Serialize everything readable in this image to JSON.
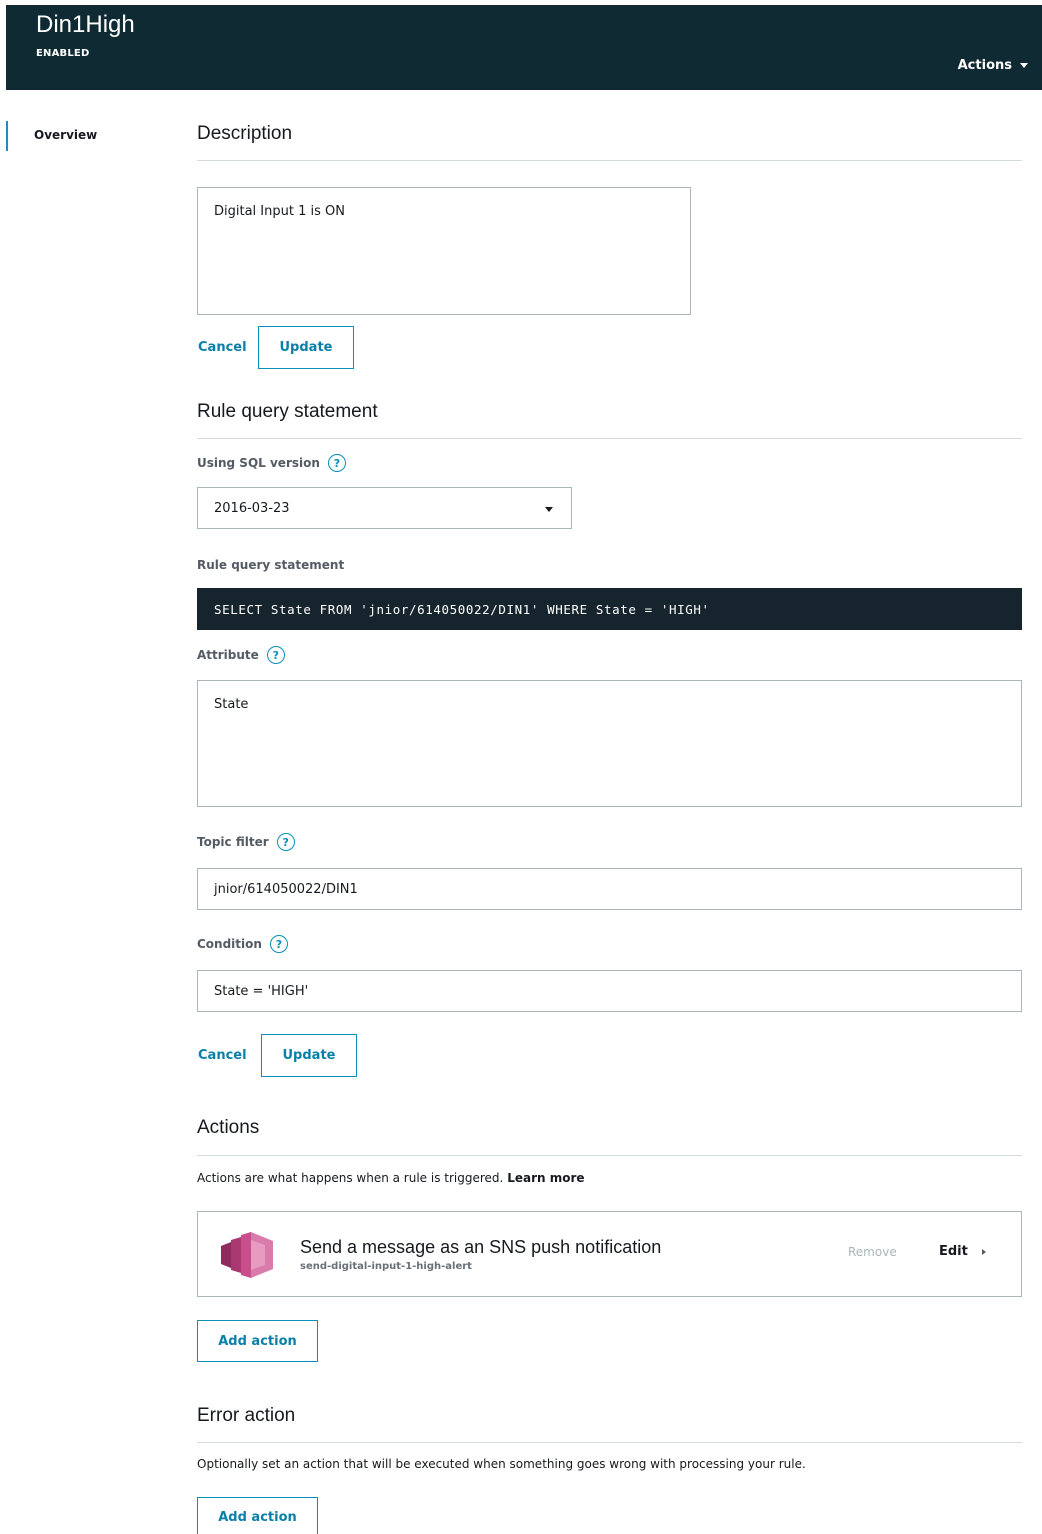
{
  "header": {
    "title": "Din1High",
    "status": "ENABLED",
    "actions_label": "Actions"
  },
  "nav": {
    "overview_label": "Overview"
  },
  "description": {
    "section_title": "Description",
    "value": "Digital Input 1 is ON",
    "cancel_label": "Cancel",
    "update_label": "Update"
  },
  "rule_query": {
    "section_title": "Rule query statement",
    "sql_version_label": "Using SQL version",
    "sql_version_value": "2016-03-23",
    "statement_label": "Rule query statement",
    "statement_value": "SELECT State FROM 'jnior/614050022/DIN1' WHERE State = 'HIGH'",
    "attribute_label": "Attribute",
    "attribute_value": "State",
    "topic_filter_label": "Topic filter",
    "topic_filter_value": "jnior/614050022/DIN1",
    "condition_label": "Condition",
    "condition_value": "State = 'HIGH'",
    "cancel_label": "Cancel",
    "update_label": "Update"
  },
  "actions": {
    "section_title": "Actions",
    "helper_text": "Actions are what happens when a rule is triggered.",
    "learn_more_label": "Learn more",
    "items": [
      {
        "name": "Send a message as an SNS push notification",
        "target": "send-digital-input-1-high-alert",
        "remove_label": "Remove",
        "edit_label": "Edit"
      }
    ],
    "add_action_label": "Add action"
  },
  "error_action": {
    "section_title": "Error action",
    "helper_text": "Optionally set an action that will be executed when something goes wrong with processing your rule.",
    "add_action_label": "Add action"
  },
  "icons": {
    "help": "help-circle-icon",
    "sns": "sns-service-icon",
    "dropdown": "chevron-down-icon"
  },
  "colors": {
    "header_bg": "#0f2a33",
    "accent": "#0a8fb8",
    "code_bg": "#16242e",
    "sns_icon": "#c84f8c"
  }
}
